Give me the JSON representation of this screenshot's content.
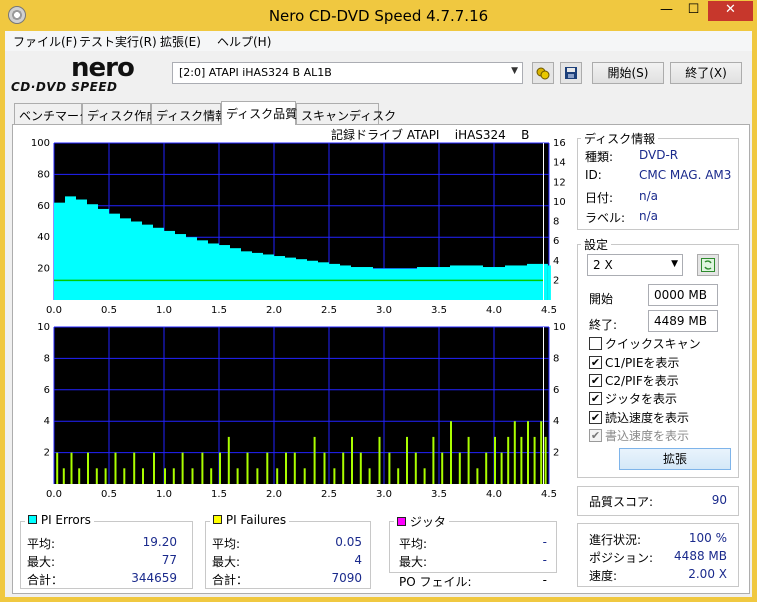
{
  "window": {
    "title": "Nero CD-DVD Speed 4.7.7.16",
    "min_label": "—",
    "max_label": "☐",
    "close_label": "✕"
  },
  "menu": [
    "ファイル(F)",
    "テスト実行(R)",
    "拡張(E)",
    "ヘルプ(H)"
  ],
  "logo": {
    "brand": "nero",
    "product": "CD·DVD SPEED"
  },
  "toolbar": {
    "drive_value": "[2:0]   ATAPI iHAS324   B AL1B",
    "start_label": "開始(S)",
    "exit_label": "終了(X)",
    "eject_icon": "eject-icon",
    "save_icon": "save-icon"
  },
  "tabs": [
    {
      "label": "ベンチマーク",
      "active": false
    },
    {
      "label": "ディスク作成",
      "active": false
    },
    {
      "label": "ディスク情報",
      "active": false
    },
    {
      "label": "ディスク品質",
      "active": true
    },
    {
      "label": "スキャンディスク",
      "active": false
    }
  ],
  "chart_caption": "記録ドライブ ATAPI    iHAS324    B",
  "chart_data": [
    {
      "type": "bar",
      "name": "PI Errors",
      "x_range": [
        0,
        4.5
      ],
      "ylim_left": [
        0,
        100
      ],
      "ylim_right": [
        0,
        16
      ],
      "x_ticks": [
        "0.0",
        "0.5",
        "1.0",
        "1.5",
        "2.0",
        "2.5",
        "3.0",
        "3.5",
        "4.0",
        "4.5"
      ],
      "y_ticks_left": [
        "100",
        "80",
        "60",
        "40",
        "20"
      ],
      "y_ticks_right": [
        "16",
        "14",
        "12",
        "10",
        "8",
        "6",
        "4",
        "2"
      ],
      "series_color": "#00ffff",
      "speed_color": "#00cc00",
      "x": [
        0.0,
        0.1,
        0.2,
        0.3,
        0.4,
        0.5,
        0.6,
        0.7,
        0.8,
        0.9,
        1.0,
        1.1,
        1.2,
        1.3,
        1.4,
        1.5,
        1.6,
        1.7,
        1.8,
        1.9,
        2.0,
        2.1,
        2.2,
        2.3,
        2.4,
        2.5,
        2.6,
        2.7,
        2.8,
        2.9,
        3.0,
        3.1,
        3.2,
        3.3,
        3.4,
        3.5,
        3.6,
        3.7,
        3.8,
        3.9,
        4.0,
        4.1,
        4.2,
        4.3,
        4.4,
        4.49
      ],
      "values": [
        62,
        66,
        64,
        61,
        58,
        55,
        52,
        50,
        48,
        46,
        44,
        42,
        40,
        38,
        36,
        35,
        33,
        31,
        30,
        29,
        28,
        27,
        26,
        25,
        24,
        23,
        22,
        21,
        21,
        20,
        20,
        20,
        20,
        21,
        21,
        21,
        22,
        22,
        22,
        21,
        21,
        22,
        22,
        23,
        23,
        22
      ],
      "speed": 2.0,
      "xlabel": "",
      "ylabel": ""
    },
    {
      "type": "bar",
      "name": "PI Failures",
      "x_range": [
        0,
        4.5
      ],
      "ylim_left": [
        0,
        10
      ],
      "x_ticks": [
        "0.0",
        "0.5",
        "1.0",
        "1.5",
        "2.0",
        "2.5",
        "3.0",
        "3.5",
        "4.0",
        "4.5"
      ],
      "y_ticks_left": [
        "10",
        "8",
        "6",
        "4",
        "2"
      ],
      "y_ticks_right": [
        "10",
        "8",
        "6",
        "4",
        "2"
      ],
      "series_color": "#aaff00",
      "x": [
        0.02,
        0.08,
        0.15,
        0.22,
        0.3,
        0.38,
        0.46,
        0.55,
        0.63,
        0.72,
        0.8,
        0.9,
        1.0,
        1.08,
        1.16,
        1.25,
        1.34,
        1.42,
        1.5,
        1.58,
        1.66,
        1.75,
        1.84,
        1.93,
        2.02,
        2.1,
        2.18,
        2.27,
        2.36,
        2.45,
        2.54,
        2.62,
        2.7,
        2.78,
        2.86,
        2.95,
        3.04,
        3.12,
        3.2,
        3.28,
        3.36,
        3.44,
        3.52,
        3.6,
        3.68,
        3.76,
        3.84,
        3.92,
        4.0,
        4.06,
        4.12,
        4.18,
        4.24,
        4.3,
        4.36,
        4.42,
        4.46
      ],
      "values": [
        2,
        1,
        2,
        1,
        2,
        1,
        1,
        2,
        1,
        2,
        1,
        2,
        1,
        1,
        2,
        1,
        2,
        1,
        2,
        3,
        1,
        2,
        1,
        2,
        1,
        2,
        2,
        1,
        3,
        2,
        1,
        2,
        3,
        2,
        1,
        3,
        2,
        1,
        3,
        2,
        1,
        3,
        2,
        4,
        2,
        3,
        1,
        2,
        3,
        2,
        3,
        4,
        3,
        4,
        3,
        4,
        3
      ],
      "xlabel": "",
      "ylabel": ""
    }
  ],
  "disc_info": {
    "title": "ディスク情報",
    "rows": [
      {
        "label": "種類:",
        "value": "DVD-R"
      },
      {
        "label": "ID:",
        "value": "CMC MAG. AM3"
      },
      {
        "label": "日付:",
        "value": "n/a"
      },
      {
        "label": "ラベル:",
        "value": "n/a"
      }
    ]
  },
  "settings": {
    "title": "設定",
    "speed": "2 X",
    "start_label": "開始",
    "start_value": "0000 MB",
    "end_label": "終了:",
    "end_value": "4489 MB",
    "checkboxes": [
      {
        "label": "クイックスキャン",
        "checked": false,
        "disabled": false
      },
      {
        "label": "C1/PIEを表示",
        "checked": true,
        "disabled": false
      },
      {
        "label": "C2/PIFを表示",
        "checked": true,
        "disabled": false
      },
      {
        "label": "ジッタを表示",
        "checked": true,
        "disabled": false
      },
      {
        "label": "読込速度を表示",
        "checked": true,
        "disabled": false
      },
      {
        "label": "書込速度を表示",
        "checked": true,
        "disabled": true
      }
    ],
    "advanced_label": "拡張"
  },
  "quality": {
    "label": "品質スコア:",
    "value": "90"
  },
  "progress": {
    "rows": [
      {
        "label": "進行状況:",
        "value": "100 %"
      },
      {
        "label": "ポジション:",
        "value": "4488 MB"
      },
      {
        "label": "速度:",
        "value": "2.00 X"
      }
    ]
  },
  "stats": {
    "pi_errors": {
      "title": "PI Errors",
      "color": "#00ffff",
      "avg_label": "平均:",
      "avg": "19.20",
      "max_label": "最大:",
      "max": "77",
      "total_label": "合計：",
      "total": "344659"
    },
    "pi_failures": {
      "title": "PI Failures",
      "color": "#ffff00",
      "avg_label": "平均:",
      "avg": "0.05",
      "max_label": "最大:",
      "max": "4",
      "total_label": "合計：",
      "total": "7090"
    },
    "jitter": {
      "title": "ジッタ",
      "color": "#ff00ff",
      "avg_label": "平均:",
      "avg": "-",
      "max_label": "最大:",
      "max": "-"
    },
    "po_label": "PO フェイル:",
    "po_value": "-"
  }
}
